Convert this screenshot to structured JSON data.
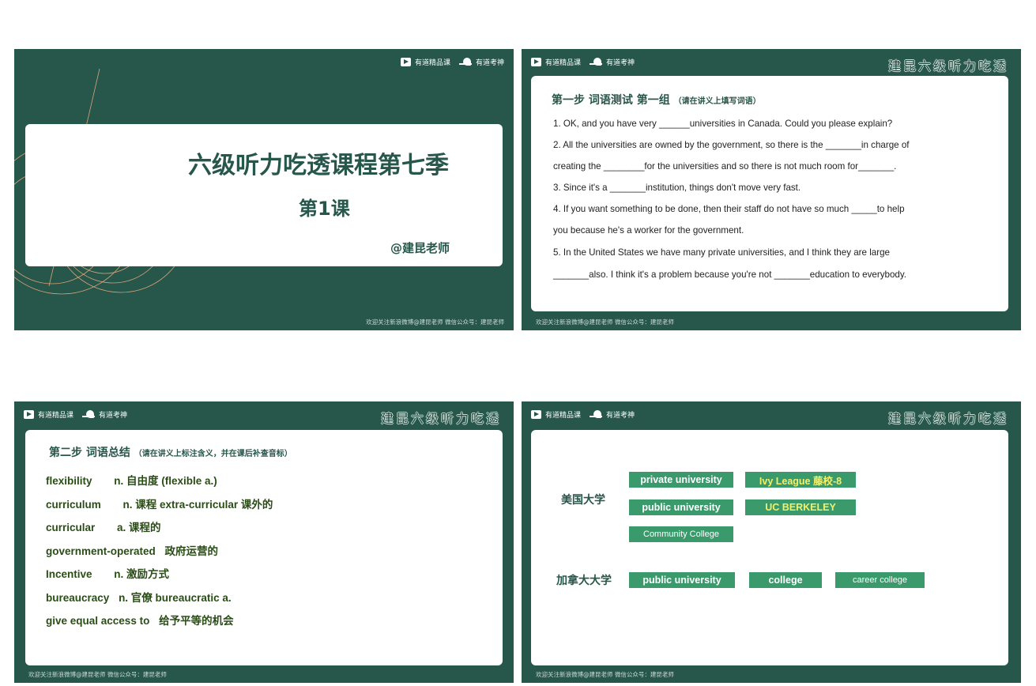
{
  "brand": {
    "product": "有道精品课",
    "app": "有道考神"
  },
  "series_logo": "建昆六级听力吃透",
  "footer": "欢迎关注新浪微博@建昆老师 微信公众号：建昆老师",
  "slide1": {
    "title": "六级听力吃透课程第七季",
    "lesson": "第1课",
    "teacher": "@建昆老师"
  },
  "slide2": {
    "step_title": "第一步 词语测试 第一组",
    "step_note": "（请在讲义上填写词语）",
    "lines": [
      "1. OK, and you have very ______universities in Canada. Could you please explain?",
      "2. All the universities are owned by the government, so there is the _______in charge of",
      "creating the ________for the universities and so there is not much room for_______.",
      "3. Since it's a _______institution, things don't move very fast.",
      "4. If you want something to be done, then their staff do not have so much _____to help",
      "you because he's a worker for the government.",
      "5. In the United States we have many private universities, and I think they are large",
      "_______also. I think it's a problem because you're not _______education to everybody."
    ]
  },
  "slide3": {
    "step_title": "第二步 词语总结",
    "step_note": "（请在讲义上标注含义，并在课后补查音标）",
    "rows": [
      {
        "a": "flexibility",
        "b": "n. 自由度 (flexible a.)"
      },
      {
        "a": "curriculum",
        "b": "n. 课程    extra-curricular 课外的"
      },
      {
        "a": "curricular",
        "b": "a. 课程的"
      },
      {
        "a": "government-operated",
        "b": "政府运营的"
      },
      {
        "a": "Incentive",
        "b": "n. 激励方式"
      },
      {
        "a": "bureaucracy",
        "b": "n.  官僚   bureaucratic  a."
      },
      {
        "a": "give equal access to",
        "b": "给予平等的机会"
      }
    ]
  },
  "slide4": {
    "usa": {
      "label": "美国大学",
      "tags": [
        "private university",
        "Ivy League 藤校-8",
        "public university",
        "UC BERKELEY",
        "Community College"
      ]
    },
    "canada": {
      "label": "加拿大大学",
      "tags": [
        "public university",
        "college",
        "career college"
      ]
    }
  }
}
